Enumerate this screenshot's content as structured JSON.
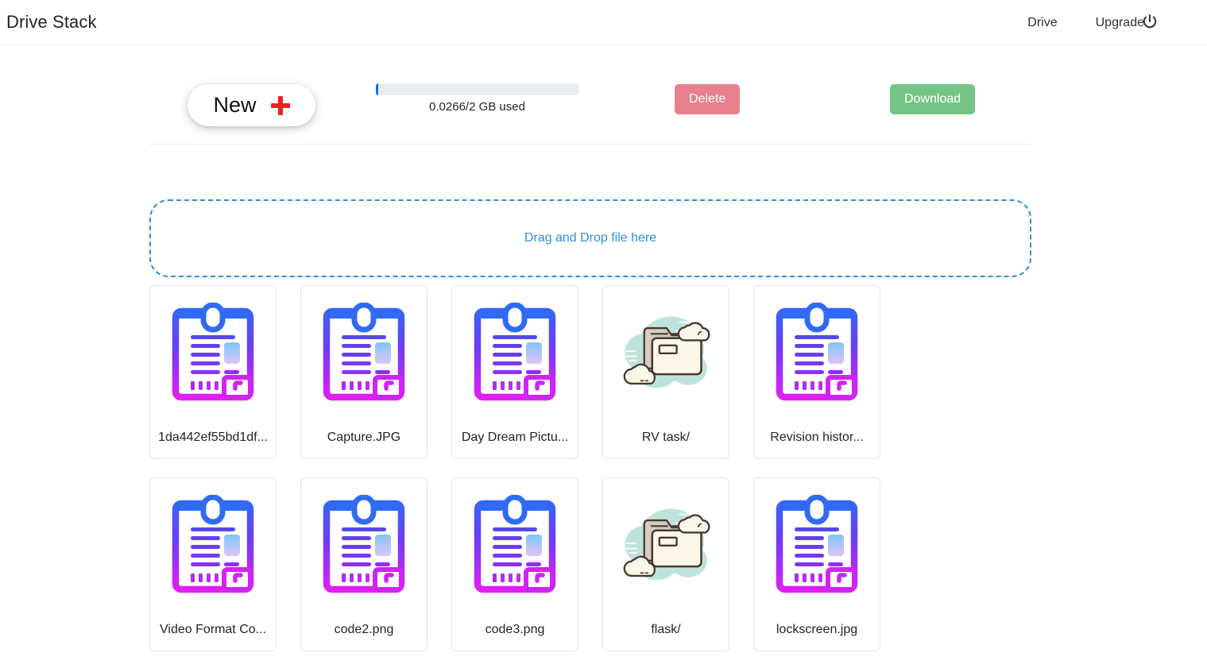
{
  "header": {
    "brand": "Drive Stack",
    "links": [
      {
        "label": "Drive",
        "name": "nav-link-drive"
      },
      {
        "label": "Upgrade",
        "name": "nav-link-upgrade"
      }
    ],
    "power_icon": "power-icon"
  },
  "toolbar": {
    "new_label": "New",
    "plus_icon": "plus-icon",
    "storage": {
      "used_gb": 0.0266,
      "total_gb": 2,
      "percent": 1.33,
      "text": "0.0266/2 GB used",
      "fill_color": "#0d6efd",
      "track_color": "#e9ecef"
    },
    "delete_label": "Delete",
    "delete_color": "#e9808d",
    "download_label": "Download",
    "download_color": "#74c586"
  },
  "dropzone": {
    "text": "Drag and Drop file here",
    "accent_color": "#2f8fd4"
  },
  "files": [
    {
      "label": "1da442ef55bd1df...",
      "icon": "document-icon",
      "type": "file"
    },
    {
      "label": "Capture.JPG",
      "icon": "document-icon",
      "type": "file"
    },
    {
      "label": "Day Dream Pictu...",
      "icon": "document-icon",
      "type": "file"
    },
    {
      "label": "RV task/",
      "icon": "folder-icon",
      "type": "folder"
    },
    {
      "label": "Revision histor...",
      "icon": "document-icon",
      "type": "file"
    },
    {
      "label": "Video Format Co...",
      "icon": "document-icon",
      "type": "file"
    },
    {
      "label": "code2.png",
      "icon": "document-icon",
      "type": "file"
    },
    {
      "label": "code3.png",
      "icon": "document-icon",
      "type": "file"
    },
    {
      "label": "flask/",
      "icon": "folder-icon",
      "type": "folder"
    },
    {
      "label": "lockscreen.jpg",
      "icon": "document-icon",
      "type": "file"
    }
  ]
}
